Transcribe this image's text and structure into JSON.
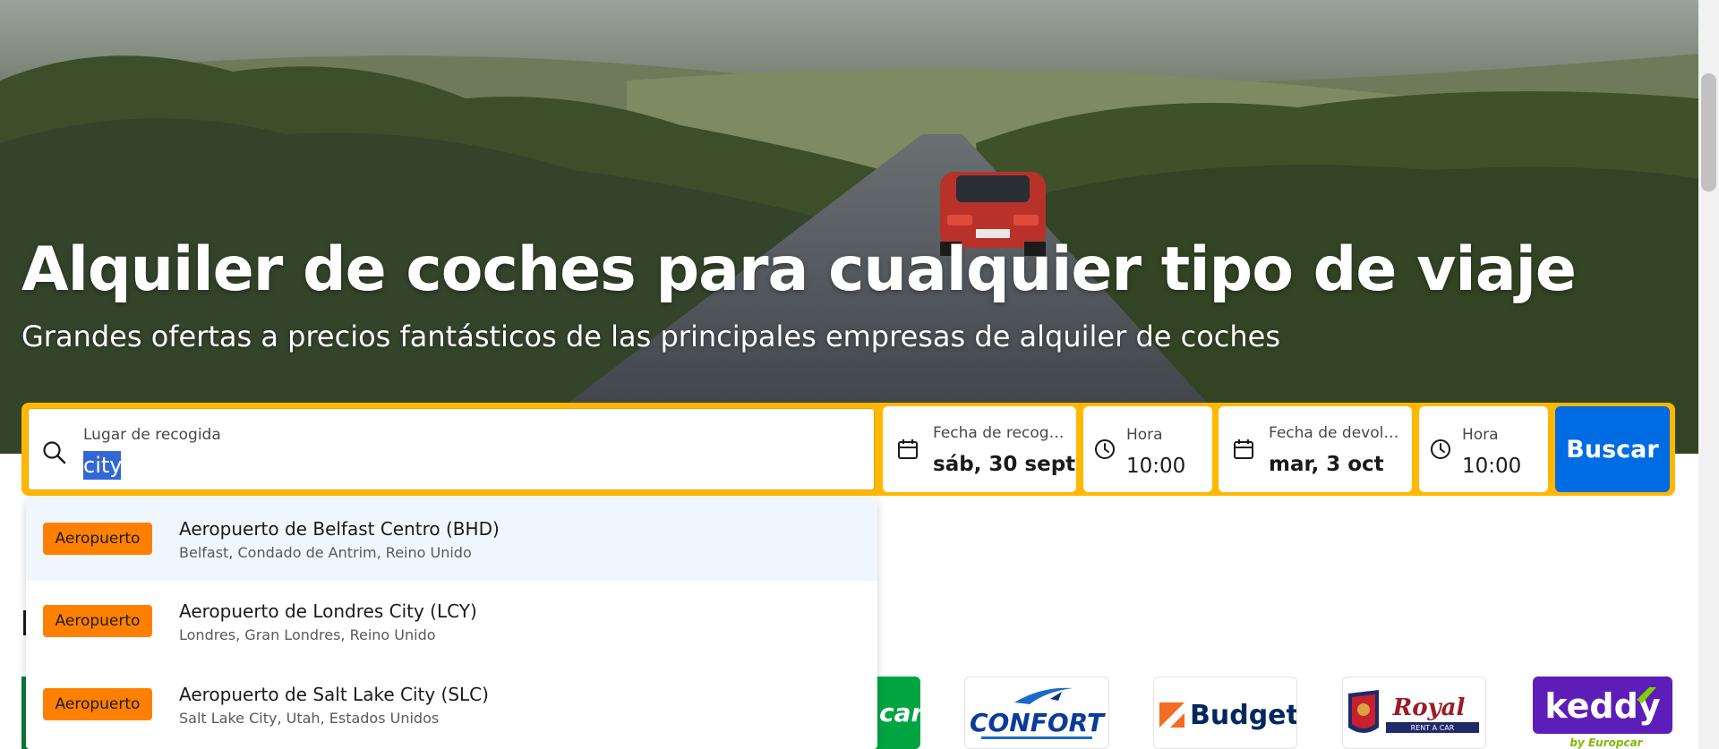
{
  "hero": {
    "title": "Alquiler de coches para cualquier tipo de viaje",
    "subtitle": "Grandes ofertas a precios fantásticos de las principales empresas de alquiler de coches"
  },
  "search": {
    "location_label": "Lugar de recogida",
    "location_value": "city",
    "pickup_date_label": "Fecha de recogi...",
    "pickup_date_value": "sáb, 30 sept",
    "pickup_time_label": "Hora",
    "pickup_time_value": "10:00",
    "dropoff_date_label": "Fecha de devolu...",
    "dropoff_date_value": "mar, 3 oct",
    "dropoff_time_label": "Hora",
    "dropoff_time_value": "10:00",
    "search_button": "Buscar",
    "accent_color": "#ffb700",
    "button_color": "#006ce4"
  },
  "suggestions": [
    {
      "badge": "Aeropuerto",
      "title": "Aeropuerto de Belfast Centro (BHD)",
      "subtitle": "Belfast, Condado de Antrim, Reino Unido"
    },
    {
      "badge": "Aeropuerto",
      "title": "Aeropuerto de Londres City (LCY)",
      "subtitle": "Londres, Gran Londres, Reino Unido"
    },
    {
      "badge": "Aeropuerto",
      "title": "Aeropuerto de Salt Lake City (SLC)",
      "subtitle": "Salt Lake City, Utah, Estados Unidos"
    }
  ],
  "brands": {
    "europcar_fragment": "car",
    "confort": "CONFORT",
    "budget": "Budget",
    "royal": "Royal",
    "royal_tagline": "RENT A CAR",
    "keddy": "keddy",
    "keddy_tagline": "by Europcar"
  }
}
